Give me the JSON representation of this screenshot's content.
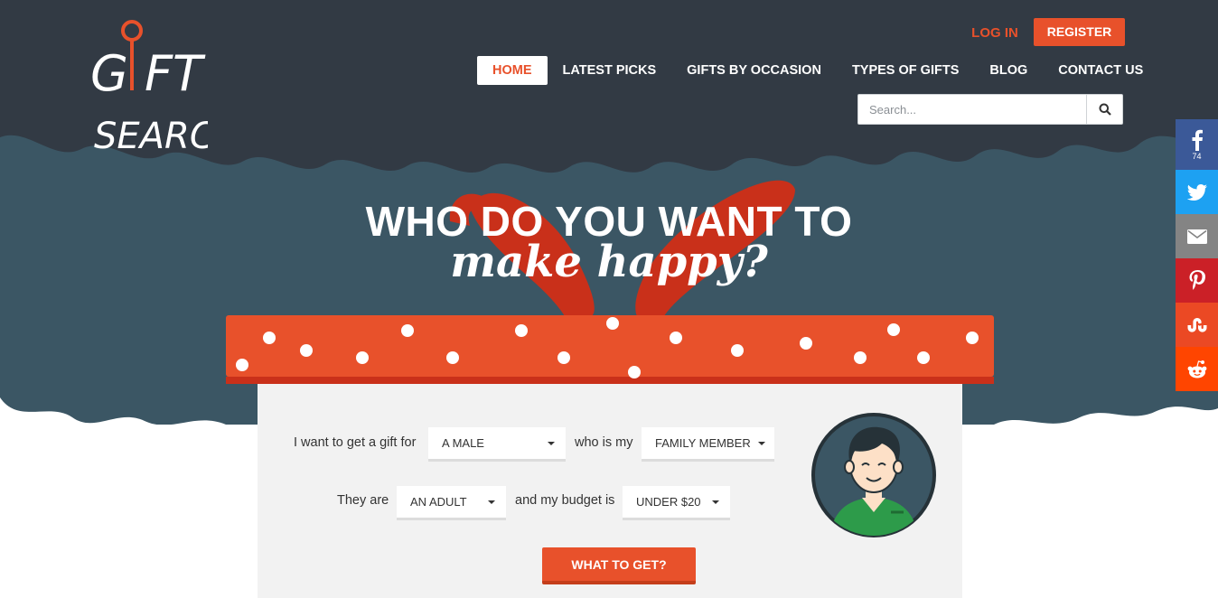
{
  "brand": {
    "logo_text": "GIFT SEARCH",
    "colors": {
      "accent": "#e8512b",
      "dark_bg": "#323a44",
      "teal_bg": "#3b5664",
      "card_bg": "#f2f2f2"
    }
  },
  "header": {
    "login_label": "LOG IN",
    "register_label": "REGISTER",
    "nav": [
      {
        "label": "HOME",
        "active": true
      },
      {
        "label": "LATEST PICKS"
      },
      {
        "label": "GIFTS BY OCCASION"
      },
      {
        "label": "TYPES OF GIFTS"
      },
      {
        "label": "BLOG"
      },
      {
        "label": "CONTACT US"
      }
    ],
    "search": {
      "placeholder": "Search...",
      "icon": "search-icon"
    }
  },
  "hero": {
    "headline_top": "WHO DO YOU WANT TO",
    "headline_bottom": "make happy?"
  },
  "form": {
    "row1": {
      "prefix": "I want to get a gift for",
      "gender_value": "A MALE",
      "middle": "who is my",
      "relation_value": "FAMILY MEMBER"
    },
    "row2": {
      "prefix": "They are",
      "age_value": "AN ADULT",
      "middle": "and my budget is",
      "budget_value": "UNDER $20"
    },
    "submit_label": "WHAT TO GET?",
    "avatar_icon": "male-avatar-icon"
  },
  "share_bar": [
    {
      "network": "facebook",
      "icon": "facebook-icon",
      "count": "74",
      "color": "#3b5998"
    },
    {
      "network": "twitter",
      "icon": "twitter-icon",
      "color": "#1da1f2"
    },
    {
      "network": "email",
      "icon": "email-icon",
      "color": "#848484"
    },
    {
      "network": "pinterest",
      "icon": "pinterest-icon",
      "color": "#cb2027"
    },
    {
      "network": "stumbleupon",
      "icon": "stumbleupon-icon",
      "color": "#eb4924"
    },
    {
      "network": "reddit",
      "icon": "reddit-icon",
      "color": "#ff4500"
    }
  ]
}
